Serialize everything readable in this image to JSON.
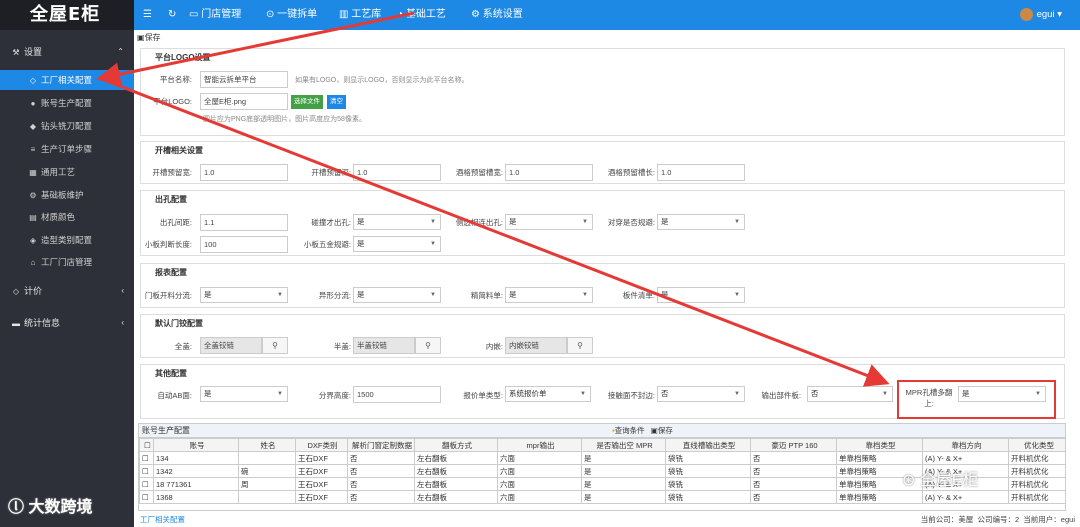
{
  "brand": "全屋E柜",
  "sidebar": {
    "groups": [
      {
        "label": "设置",
        "icon": "wrench-icon"
      },
      {
        "label": "计价",
        "icon": "gem-icon"
      },
      {
        "label": "统计信息",
        "icon": "chat-icon"
      }
    ],
    "items": [
      {
        "label": "工厂相关配置"
      },
      {
        "label": "账号生产配置"
      },
      {
        "label": "钻头铣刀配置"
      },
      {
        "label": "生产订单步骤"
      },
      {
        "label": "通用工艺"
      },
      {
        "label": "基础板维护"
      },
      {
        "label": "材质颜色"
      },
      {
        "label": "造型类别配置"
      },
      {
        "label": "工厂门店管理"
      }
    ]
  },
  "topnav": {
    "tabs": [
      {
        "label": "门店管理"
      },
      {
        "label": "一键拆单"
      },
      {
        "label": "工艺库"
      },
      {
        "label": "基础工艺"
      },
      {
        "label": "系统设置"
      }
    ],
    "user": "egui"
  },
  "toolbar": {
    "save": "保存"
  },
  "logo_section": {
    "title": "平台LOGO设置",
    "name_label": "平台名称:",
    "name_value": "智能云拆单平台",
    "name_hint": "如果有LOGO，则显示LOGO，否则显示为此平台名称。",
    "logo_label": "平台LOGO:",
    "logo_value": "全屋E柜.png",
    "choose_btn": "选择文件",
    "clear_btn": "清空",
    "logo_hint": "图片应为PNG底部透明图片，图片高度应为58像素。"
  },
  "slot_section": {
    "title": "开槽相关设置",
    "fields": [
      {
        "label": "开槽预留宽:",
        "value": "1.0"
      },
      {
        "label": "开槽预留深:",
        "value": "1.0"
      },
      {
        "label": "酒格预留槽宽:",
        "value": "1.0"
      },
      {
        "label": "酒格预留槽长:",
        "value": "1.0"
      }
    ]
  },
  "hole_section": {
    "title": "出孔配置",
    "r1": [
      {
        "label": "出孔间距:",
        "value": "1.1",
        "type": "input"
      },
      {
        "label": "碰撞才出孔:",
        "value": "是",
        "type": "select"
      },
      {
        "label": "侧边相连出孔:",
        "value": "是",
        "type": "select"
      },
      {
        "label": "对穿是否规避:",
        "value": "是",
        "type": "select"
      }
    ],
    "r2": [
      {
        "label": "小板判断长度:",
        "value": "100",
        "type": "input"
      },
      {
        "label": "小板五金规避:",
        "value": "是",
        "type": "select"
      }
    ]
  },
  "report_section": {
    "title": "报表配置",
    "fields": [
      {
        "label": "门板开料分流:",
        "value": "是"
      },
      {
        "label": "异形分流:",
        "value": "是"
      },
      {
        "label": "精简料单:",
        "value": "是"
      },
      {
        "label": "板件清单:",
        "value": "是"
      }
    ]
  },
  "hinge_section": {
    "title": "默认门铰配置",
    "fields": [
      {
        "label": "全盖:",
        "value": "全盖铰链"
      },
      {
        "label": "半盖:",
        "value": "半盖铰链"
      },
      {
        "label": "内嵌:",
        "value": "内嵌铰链"
      }
    ]
  },
  "other_section": {
    "title": "其他配置",
    "fields": [
      {
        "label": "自动AB面:",
        "value": "是",
        "type": "select"
      },
      {
        "label": "分界高度:",
        "value": "1500",
        "type": "input"
      },
      {
        "label": "报价单类型:",
        "value": "系统报价单",
        "type": "select"
      },
      {
        "label": "接触面不封边:",
        "value": "否",
        "type": "select"
      },
      {
        "label": "输出部件板:",
        "value": "否",
        "type": "select"
      },
      {
        "label": "MPR孔槽多翻上:",
        "value": "是",
        "type": "select"
      }
    ]
  },
  "grid": {
    "title": "账号生产配置",
    "query_btn": "查询条件",
    "save_btn": "保存",
    "columns": [
      "账号",
      "姓名",
      "DXF类别",
      "解析门窗定制数据",
      "翻板方式",
      "mpr输出",
      "是否输出空 MPR",
      "直线槽输出类型",
      "豪迈 PTP 160",
      "靠档类型",
      "靠档方向",
      "优化类型"
    ],
    "rows": [
      [
        "134",
        "",
        "王石DXF",
        "否",
        "左右翻板",
        "六面",
        "是",
        "袋铣",
        "否",
        "单靠档策略",
        "(A) Y- & X+",
        "开料机优化"
      ],
      [
        "1342",
        "碗",
        "王石DXF",
        "否",
        "左右翻板",
        "六面",
        "是",
        "袋铣",
        "否",
        "单靠档策略",
        "(A) Y- & X+",
        "开料机优化"
      ],
      [
        "18     771361",
        "周",
        "王石DXF",
        "否",
        "左右翻板",
        "六面",
        "是",
        "袋铣",
        "否",
        "单靠档策略",
        "(A) Y- & X+",
        "开料机优化"
      ],
      [
        "1368",
        "",
        "王石DXF",
        "否",
        "左右翻板",
        "六面",
        "是",
        "袋铣",
        "否",
        "单靠档策略",
        "(A) Y- & X+",
        "开料机优化"
      ]
    ]
  },
  "footer": {
    "left": "工厂相关配置",
    "company": "当前公司：美屋",
    "company_no": "公司编号：2",
    "current_user": "当前用户：egui"
  },
  "watermarks": {
    "left": "大数跨境",
    "right": "全屋E柜"
  },
  "colors": {
    "primary": "#1e88e5",
    "sidebar": "#2d3038",
    "annotation": "#e53935"
  }
}
